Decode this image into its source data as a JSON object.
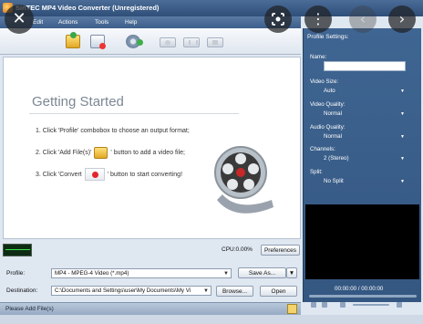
{
  "window": {
    "title": "SinTEC MP4 Video Converter (Unregistered)"
  },
  "menu": {
    "items": [
      "Edit",
      "Actions",
      "Tools",
      "Help"
    ]
  },
  "getting_started": {
    "title": "Getting Started",
    "step1": "1. Click 'Profile' combobox to choose an output format;",
    "step2_pre": "2. Click 'Add File(s)'",
    "step2_post": "' button to add a video file;",
    "step3_pre": "3. Click 'Convert",
    "step3_post": "' button to start converting!"
  },
  "cpu": {
    "label": "CPU:0.00%",
    "preferences_label": "Preferences"
  },
  "profile": {
    "label": "Profile:",
    "value": "MP4 - MPEG-4 Video (*.mp4)",
    "save_as_label": "Save As..."
  },
  "destination": {
    "label": "Destination:",
    "value": "C:\\Documents and Settings\\user\\My Documents\\My Vi",
    "browse_label": "Browse...",
    "open_label": "Open"
  },
  "status": {
    "text": "Please Add File(s)"
  },
  "settings": {
    "header": "Profile Settings:",
    "name_label": "Name:",
    "video_size_label": "Video Size:",
    "video_size_value": "Auto",
    "video_quality_label": "Video Quality:",
    "video_quality_value": "Normal",
    "audio_quality_label": "Audio Quality:",
    "audio_quality_value": "Normal",
    "channels_label": "Channels:",
    "channels_value": "2 (Stereo)",
    "split_label": "Split:",
    "split_value": "No Split"
  },
  "player": {
    "time": "00:00:00 / 00:00:00"
  },
  "overlay": {
    "close": "✕",
    "more": "⋮",
    "prev": "‹",
    "next": "›"
  }
}
